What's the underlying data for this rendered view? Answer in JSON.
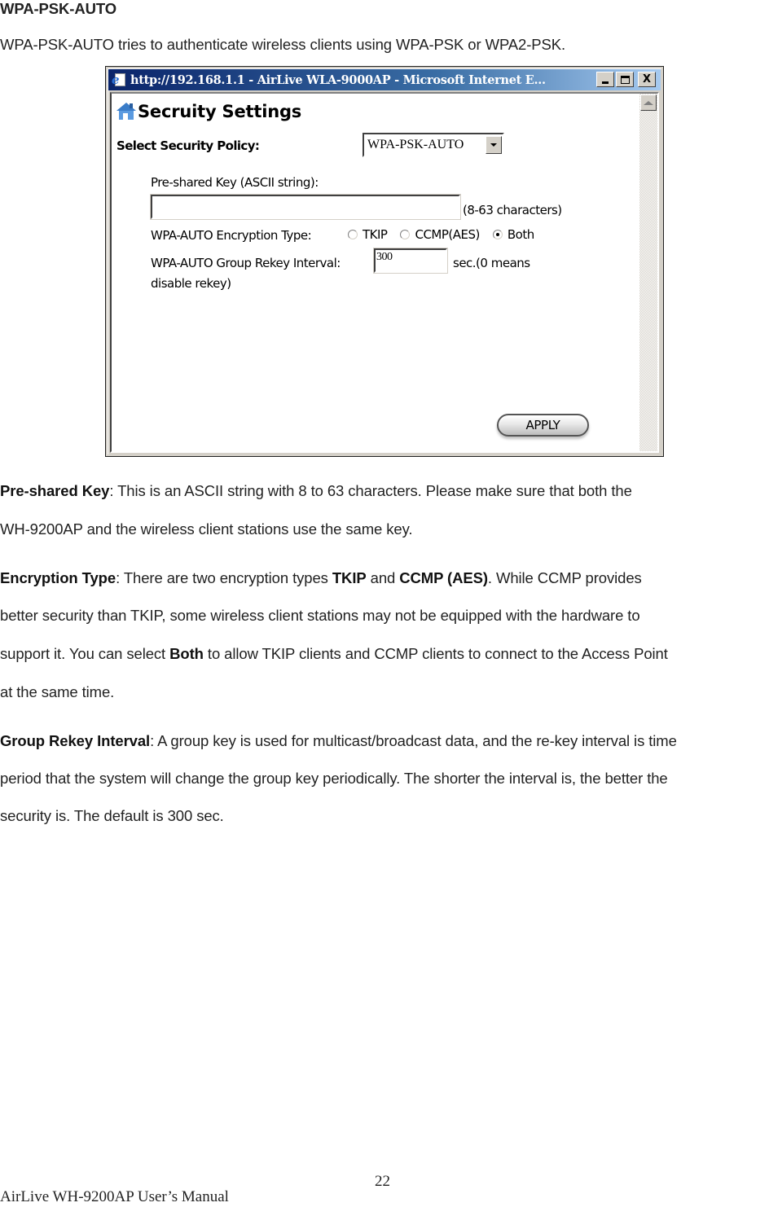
{
  "document": {
    "heading": "WPA-PSK-AUTO",
    "intro": "WPA-PSK-AUTO tries to authenticate wireless clients using WPA-PSK or WPA2-PSK.",
    "paragraphs": {
      "psk": {
        "term": "Pre-shared Key",
        "line1": ": This is an ASCII string with 8 to 63 characters. Please make sure that both the",
        "line2": "WH-9200AP and the wireless client stations use the same key."
      },
      "encryption": {
        "term": "Encryption Type",
        "line1_a": ": There are two encryption types ",
        "line1_b": "TKIP",
        "line1_c": " and ",
        "line1_d": "CCMP (AES)",
        "line1_e": ". While CCMP provides",
        "line2": "better security than TKIP, some wireless client stations may not be equipped with the hardware to",
        "line3_a": "support it. You can select ",
        "line3_b": "Both",
        "line3_c": " to allow TKIP clients and CCMP clients to connect to the Access Point",
        "line4": "at the same time."
      },
      "rekey": {
        "term": "Group Rekey Interval",
        "line1": ": A group key is used for multicast/broadcast data, and the re-key interval is time",
        "line2": "period that the system will change the group key periodically. The shorter the interval is, the better the",
        "line3": "security is. The default is 300 sec."
      }
    },
    "footer": {
      "page_number": "22",
      "manual_title": "AirLive WH-9200AP User’s Manual"
    }
  },
  "browser_window": {
    "title": "http://192.168.1.1 - AirLive WLA-9000AP - Microsoft Internet E...",
    "buttons": {
      "minimize": "minimize",
      "maximize": "maximize",
      "close": "X"
    },
    "page": {
      "title": "Secruity Settings",
      "policy_label": "Select Security Policy:",
      "policy_value": "WPA-PSK-AUTO",
      "psk_label": "Pre-shared Key (ASCII string):",
      "psk_value": "",
      "psk_hint": "(8-63 characters)",
      "encryption_label": "WPA-AUTO Encryption Type:",
      "encryption_options": [
        {
          "label": "TKIP",
          "selected": false
        },
        {
          "label": "CCMP(AES)",
          "selected": false
        },
        {
          "label": "Both",
          "selected": true
        }
      ],
      "rekey_label": "WPA-AUTO Group Rekey Interval:",
      "rekey_value": "300",
      "rekey_hint_1": "sec.(0 means",
      "rekey_hint_2": "disable rekey)",
      "apply_label": "APPLY"
    }
  }
}
